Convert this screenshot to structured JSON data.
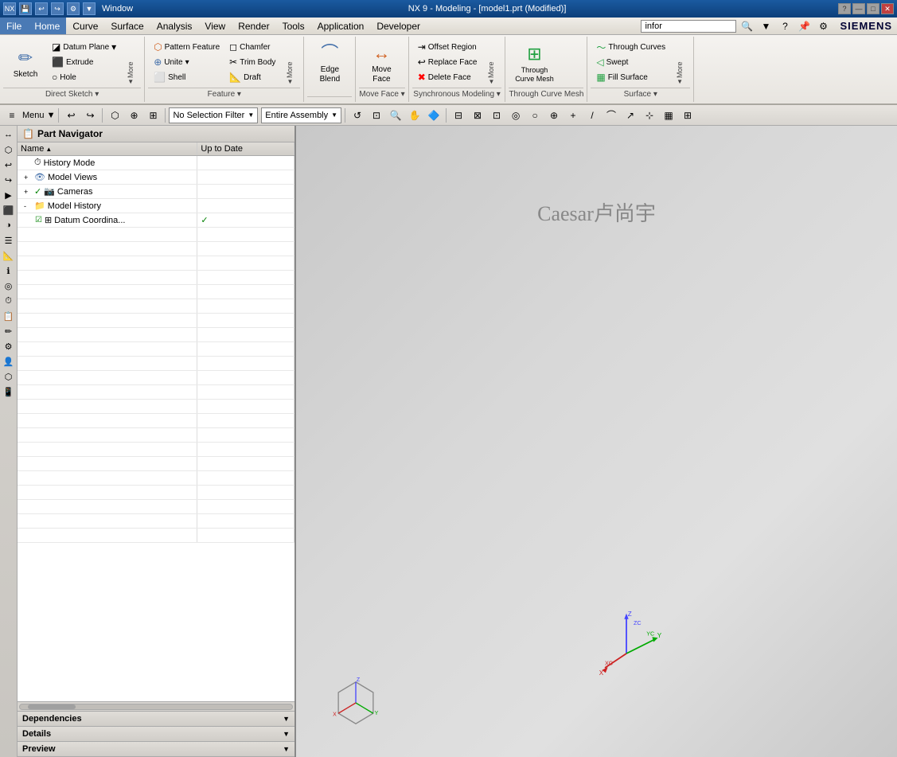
{
  "titleBar": {
    "title": "NX 9 - Modeling - [model1.prt (Modified)]",
    "siemensLabel": "SIEMENS",
    "windowLabel": "Window",
    "controls": [
      "—",
      "□",
      "✕"
    ]
  },
  "menuBar": {
    "items": [
      "File",
      "Home",
      "Curve",
      "Surface",
      "Analysis",
      "View",
      "Render",
      "Tools",
      "Application",
      "Developer"
    ]
  },
  "ribbon": {
    "groups": [
      {
        "name": "directSketch",
        "label": "Direct Sketch",
        "items": [
          "Sketch",
          "Datum Plane",
          "Extrude",
          "Hole",
          "More"
        ]
      },
      {
        "name": "feature",
        "label": "Feature",
        "items": [
          "Pattern Feature",
          "Unite",
          "Shell",
          "Chamfer",
          "Trim Body",
          "Draft",
          "More"
        ]
      },
      {
        "name": "edgeBlend",
        "label": "",
        "items": [
          "Edge Blend"
        ]
      },
      {
        "name": "moveFace",
        "label": "Move Face",
        "items": [
          "Move Face"
        ]
      },
      {
        "name": "synchronousModeling",
        "label": "Synchronous Modeling",
        "items": [
          "Offset Region",
          "Replace Face",
          "Delete Face",
          "More"
        ]
      },
      {
        "name": "throughCurveMesh",
        "label": "Through Curve Mesh",
        "items": [
          "Through Curve Mesh"
        ]
      },
      {
        "name": "surface",
        "label": "Surface",
        "items": [
          "Through Curves",
          "Swept",
          "Fill Surface",
          "More"
        ]
      }
    ]
  },
  "search": {
    "placeholder": "infor",
    "value": "infor"
  },
  "commandBar": {
    "selectionFilter": "No Selection Filter",
    "assembly": "Entire Assembly",
    "menu": "Menu ▼"
  },
  "partNavigator": {
    "title": "Part Navigator",
    "columns": [
      "Name",
      "Up to Date"
    ],
    "items": [
      {
        "id": "historyMode",
        "label": "History Mode",
        "icon": "⏱",
        "level": 1,
        "hasExpand": false,
        "upToDate": ""
      },
      {
        "id": "modelViews",
        "label": "Model Views",
        "icon": "👁",
        "level": 1,
        "hasExpand": true,
        "expanded": false,
        "upToDate": ""
      },
      {
        "id": "cameras",
        "label": "Cameras",
        "icon": "📷",
        "level": 1,
        "hasExpand": true,
        "expanded": false,
        "upToDate": ""
      },
      {
        "id": "modelHistory",
        "label": "Model History",
        "icon": "📁",
        "level": 1,
        "hasExpand": true,
        "expanded": true,
        "upToDate": ""
      },
      {
        "id": "datumCoord",
        "label": "Datum Coordina...",
        "icon": "⊞",
        "level": 2,
        "hasExpand": false,
        "upToDate": "✓"
      }
    ],
    "sections": [
      {
        "id": "dependencies",
        "label": "Dependencies",
        "expanded": false
      },
      {
        "id": "details",
        "label": "Details",
        "expanded": false
      },
      {
        "id": "preview",
        "label": "Preview",
        "expanded": false
      }
    ]
  },
  "viewport": {
    "watermark": "Caesar卢尚宇",
    "axesLabels": {
      "x": "X",
      "y": "Y",
      "z": "Z",
      "xc": "XC",
      "yc": "YC",
      "zc": "ZC"
    }
  },
  "icons": {
    "sketch": "✏",
    "datumPlane": "◪",
    "extrude": "⬛",
    "hole": "○",
    "patternFeature": "⬡",
    "unite": "⊕",
    "shell": "⬜",
    "chamfer": "◻",
    "trimBody": "✂",
    "draft": "📐",
    "edgeBlend": "⌒",
    "moveFace": "↔",
    "offsetRegion": "⇥",
    "replaceFace": "↩",
    "deleteFace": "✖",
    "throughCurveMesh": "⊞",
    "throughCurves": "〜",
    "swept": "◁",
    "fillSurface": "▦",
    "more": "▼",
    "search": "🔍"
  }
}
